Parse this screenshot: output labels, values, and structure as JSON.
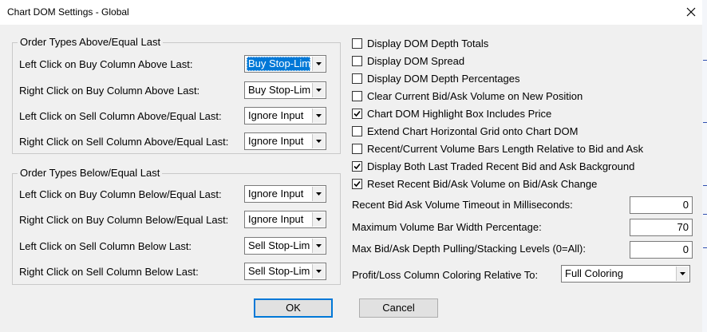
{
  "window": {
    "title": "Chart DOM Settings - Global"
  },
  "groups": {
    "above": {
      "label": "Order Types Above/Equal Last",
      "rows": [
        {
          "label": "Left Click on Buy Column Above Last:",
          "value": "Buy Stop-Limit"
        },
        {
          "label": "Right Click on Buy Column Above Last:",
          "value": "Buy Stop-Limit"
        },
        {
          "label": "Left Click on Sell Column Above/Equal Last:",
          "value": "Ignore Input"
        },
        {
          "label": "Right Click on Sell Column Above/Equal Last:",
          "value": "Ignore Input"
        }
      ]
    },
    "below": {
      "label": "Order Types Below/Equal Last",
      "rows": [
        {
          "label": "Left Click on Buy Column Below/Equal Last:",
          "value": "Ignore Input"
        },
        {
          "label": "Right Click on Buy Column Below/Equal Last:",
          "value": "Ignore Input"
        },
        {
          "label": "Left Click on Sell Column Below Last:",
          "value": "Sell Stop-Limit"
        },
        {
          "label": "Right Click on Sell Column Below Last:",
          "value": "Sell Stop-Limit"
        }
      ]
    }
  },
  "checkboxes": [
    {
      "label": "Display DOM Depth Totals",
      "checked": false
    },
    {
      "label": "Display DOM Spread",
      "checked": false
    },
    {
      "label": "Display DOM Depth Percentages",
      "checked": false
    },
    {
      "label": "Clear Current Bid/Ask Volume on New Position",
      "checked": false
    },
    {
      "label": "Chart DOM Highlight Box Includes Price",
      "checked": true
    },
    {
      "label": "Extend Chart Horizontal Grid onto Chart DOM",
      "checked": false
    },
    {
      "label": "Recent/Current Volume Bars Length Relative to Bid and Ask",
      "checked": false
    },
    {
      "label": "Display Both Last Traded Recent Bid and Ask Background",
      "checked": true
    },
    {
      "label": "Reset Recent Bid/Ask Volume on Bid/Ask Change",
      "checked": true
    }
  ],
  "fields": [
    {
      "label": "Recent Bid Ask Volume Timeout in Milliseconds:",
      "value": "0"
    },
    {
      "label": "Maximum Volume Bar Width Percentage:",
      "value": "70"
    },
    {
      "label": "Max Bid/Ask Depth Pulling/Stacking Levels (0=All):",
      "value": "0"
    }
  ],
  "pl_coloring": {
    "label": "Profit/Loss Column Coloring Relative To:",
    "value": "Full Coloring"
  },
  "buttons": {
    "ok": "OK",
    "cancel": "Cancel"
  },
  "colors": {
    "selection": "#0078d7",
    "dialog_bg": "#f0f0f0"
  }
}
